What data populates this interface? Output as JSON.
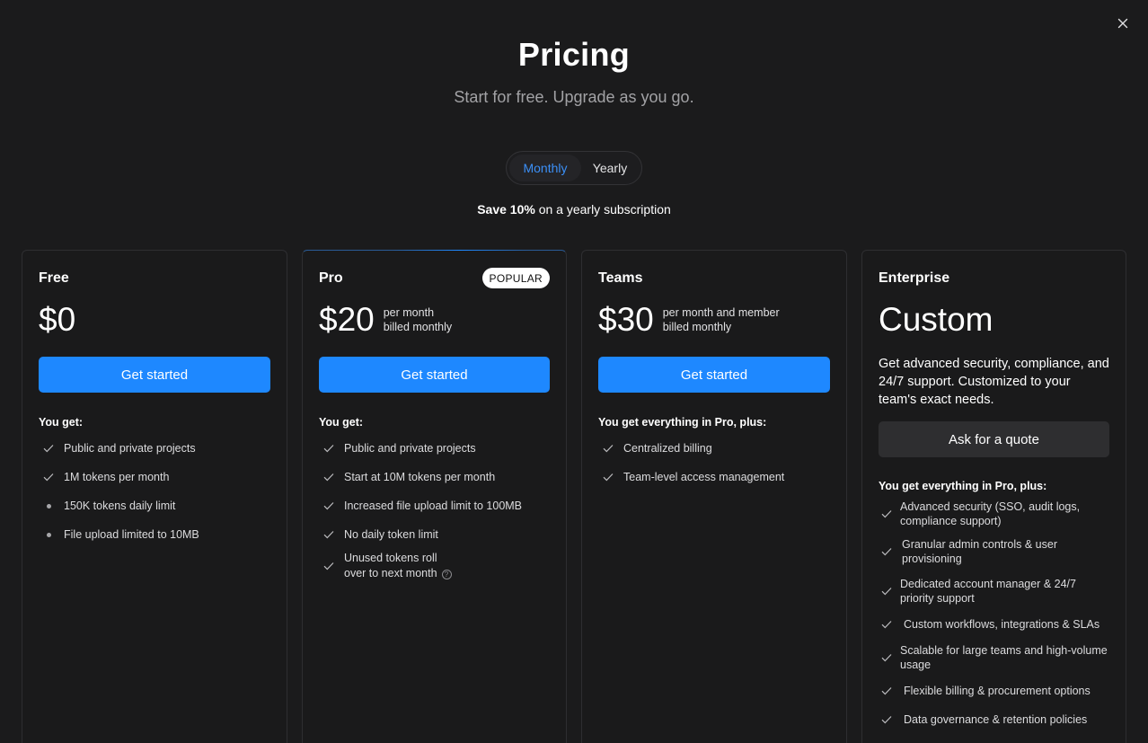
{
  "header": {
    "title": "Pricing",
    "subtitle": "Start for free. Upgrade as you go."
  },
  "billing_toggle": {
    "monthly_label": "Monthly",
    "yearly_label": "Yearly",
    "selected": "Monthly"
  },
  "save_note": {
    "bold": "Save 10%",
    "rest": " on a yearly subscription"
  },
  "colors": {
    "accent": "#1e88ff",
    "background": "#1b1b1c"
  },
  "plans": [
    {
      "name": "Free",
      "price": "$0",
      "cta": "Get started",
      "features_heading": "You get:",
      "features": [
        {
          "text": "Public and private projects",
          "icon": "check-icon"
        },
        {
          "text": "1M tokens per month",
          "icon": "check-icon"
        },
        {
          "text": "150K tokens daily limit",
          "icon": "dot-icon"
        },
        {
          "text": "File upload limited to 10MB",
          "icon": "dot-icon"
        }
      ]
    },
    {
      "name": "Pro",
      "badge": "POPULAR",
      "price": "$20",
      "price_note_1": "per month",
      "price_note_2": "billed monthly",
      "cta": "Get started",
      "features_heading": "You get:",
      "features": [
        {
          "text": "Public and private projects",
          "icon": "check-icon"
        },
        {
          "text": "Start at 10M tokens per month",
          "icon": "check-icon"
        },
        {
          "text": "Increased file upload limit to 100MB",
          "icon": "check-icon"
        },
        {
          "text": "No daily token limit",
          "icon": "check-icon"
        },
        {
          "text_line1": "Unused tokens roll",
          "text_line2": "over to next month",
          "icon": "check-icon",
          "help_icon": "question-circle-icon"
        }
      ]
    },
    {
      "name": "Teams",
      "price": "$30",
      "price_note_1": "per month and member",
      "price_note_2": "billed monthly",
      "cta": "Get started",
      "features_heading": "You get everything in Pro, plus:",
      "features": [
        {
          "text": "Centralized billing",
          "icon": "check-icon"
        },
        {
          "text": "Team-level access management",
          "icon": "check-icon"
        }
      ]
    },
    {
      "name": "Enterprise",
      "price": "Custom",
      "description": "Get advanced security, compliance, and 24/7 support. Customized to your team's exact needs.",
      "cta": "Ask for a quote",
      "features_heading": "You get everything in Pro, plus:",
      "features": [
        {
          "text": "Advanced security (SSO, audit logs, compliance support)",
          "icon": "check-icon"
        },
        {
          "text": "Granular admin controls & user provisioning",
          "icon": "check-icon"
        },
        {
          "text": "Dedicated account manager & 24/7 priority support",
          "icon": "check-icon"
        },
        {
          "text": "Custom workflows, integrations & SLAs",
          "icon": "check-icon"
        },
        {
          "text": "Scalable for large teams and high-volume usage",
          "icon": "check-icon"
        },
        {
          "text": "Flexible billing & procurement options",
          "icon": "check-icon"
        },
        {
          "text": "Data governance & retention policies",
          "icon": "check-icon"
        }
      ]
    }
  ]
}
